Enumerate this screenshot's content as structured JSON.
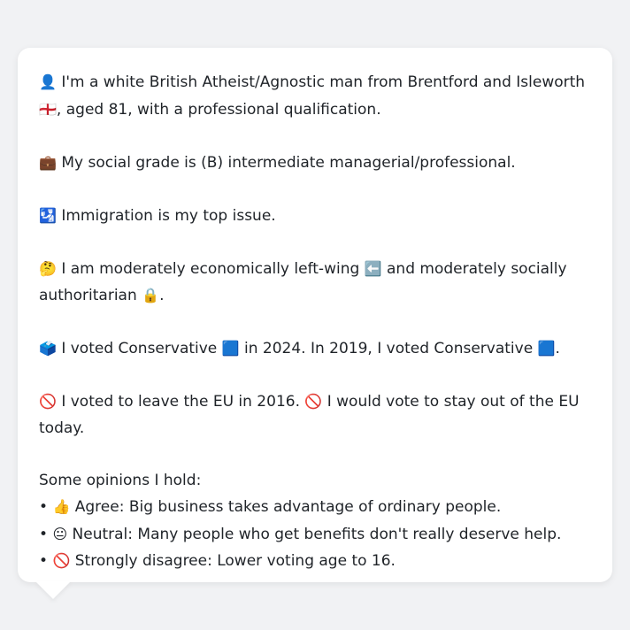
{
  "message": {
    "identity": {
      "icon": "👤",
      "text": "I'm a white British Atheist/Agnostic man from Brentford and Isleworth",
      "flag": "🏴󠁧󠁢󠁥󠁮󠁧󠁿",
      "tail": ", aged 81, with a professional qualification."
    },
    "social_grade": {
      "icon": "💼",
      "text": "My social grade is (B) intermediate managerial/professional."
    },
    "top_issue": {
      "icon": "🛂",
      "text": "Immigration is my top issue."
    },
    "politics": {
      "icon": "🤔",
      "part1": "I am moderately economically left-wing",
      "left_icon": "⬅️",
      "part2": "and moderately socially authoritarian",
      "lock_icon": "🔒",
      "end": "."
    },
    "votes": {
      "icon": "🗳️",
      "part1": "I voted Conservative",
      "party_icon_1": "🟦",
      "part2": "in 2024. In 2019, I voted Conservative",
      "party_icon_2": "🟦",
      "end": "."
    },
    "brexit": {
      "icon_1": "🚫",
      "part1": "I voted to leave the EU in 2016.",
      "icon_2": "🚫",
      "part2": "I would vote to stay out of the EU today."
    },
    "opinions": {
      "heading": "Some opinions I hold:",
      "items": [
        {
          "bullet": "•",
          "icon": "👍",
          "text": "Agree: Big business takes advantage of ordinary people."
        },
        {
          "bullet": "•",
          "icon": "😐",
          "text": "Neutral: Many people who get benefits don't really deserve help."
        },
        {
          "bullet": "•",
          "icon": "🚫",
          "text": "Strongly disagree: Lower voting age to 16."
        }
      ]
    }
  },
  "colors": {
    "background": "#f1f2f4",
    "bubble": "#ffffff",
    "text": "#1f2328"
  }
}
